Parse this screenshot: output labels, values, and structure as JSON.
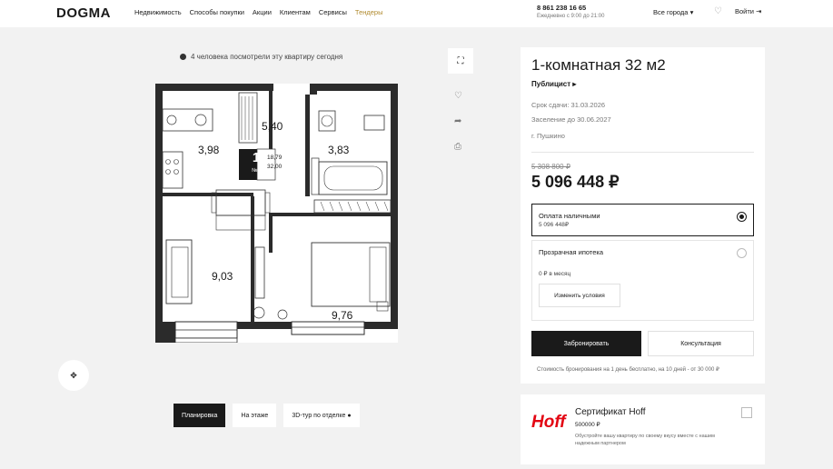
{
  "header": {
    "logo": "DOGMA",
    "nav": [
      "Недвижимость",
      "Способы покупки",
      "Акции",
      "Клиентам",
      "Сервисы"
    ],
    "tenders": "Тендеры",
    "phone": "8 861 238 16 65",
    "hours": "Ежедневно с 9:00 до 21:00",
    "city": "Все города",
    "login": "Войти"
  },
  "plan_area": {
    "viewers_text": "4 человека посмотрели эту квартиру сегодня",
    "rooms": {
      "hall": "5,40",
      "kitchen": "3,98",
      "bath": "3,83",
      "living": "9,03",
      "bedroom": "9,76"
    },
    "badge": {
      "rooms": "1",
      "number": "№4",
      "living_area": "18,79",
      "total_area": "32,00"
    },
    "tabs": [
      "Планировка",
      "На этаже",
      "3D-тур по отделке"
    ]
  },
  "card": {
    "title": "1-комнатная 32 м2",
    "complex": "Публицист",
    "delivery": "Срок сдачи: 31.03.2026",
    "settlement": "Заселение до 30.06.2027",
    "city": "г. Пушкино",
    "old_price": "5 308 800 ₽",
    "price": "5 096 448 ₽",
    "option1_name": "Оплата наличными",
    "option1_value": "5 096 448₽",
    "option2_name": "Прозрачная ипотека",
    "option2_value": "0 ₽ в месяц",
    "change_btn": "Изменить условия",
    "book_btn": "Забронировать",
    "consult_btn": "Консультация",
    "book_note": "Стоимость бронирования на 1 день бесплатно, на 10 дней - от 30 000 ₽"
  },
  "certificate": {
    "brand": "Hoff",
    "title": "Сертификат Hoff",
    "price": "500000 ₽",
    "note": "Обустройте вашу квартиру по своему вкусу вместе с нашим надежным партнером"
  }
}
